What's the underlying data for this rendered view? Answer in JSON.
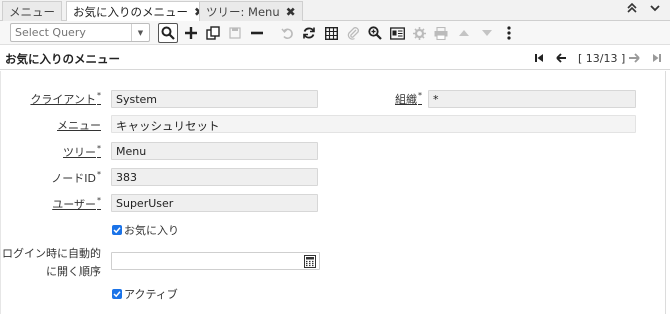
{
  "tabs": [
    {
      "label": "メニュー"
    },
    {
      "label": "お気に入りのメニュー"
    },
    {
      "label": "ツリー: Menu"
    }
  ],
  "toolbar": {
    "query_placeholder": "Select Query"
  },
  "header": {
    "title": "お気に入りのメニュー",
    "record_counter": "[ 13/13 ]"
  },
  "form": {
    "client_label": "クライアント",
    "client_value": "System",
    "org_label": "組織",
    "org_value": "*",
    "menu_label": "メニュー",
    "menu_value": "キャッシュリセット",
    "tree_label": "ツリー",
    "tree_value": "Menu",
    "node_label": "ノードID",
    "node_value": "383",
    "user_label": "ユーザー",
    "user_value": "SuperUser",
    "favorite_label": "お気に入り",
    "favorite_checked": true,
    "autoopen_label_line1": "ログイン時に自動的",
    "autoopen_label_line2": "に開く順序",
    "autoopen_value": "",
    "active_label": "アクティブ",
    "active_checked": true
  },
  "colors": {
    "checkbox": "#1a73e8"
  }
}
